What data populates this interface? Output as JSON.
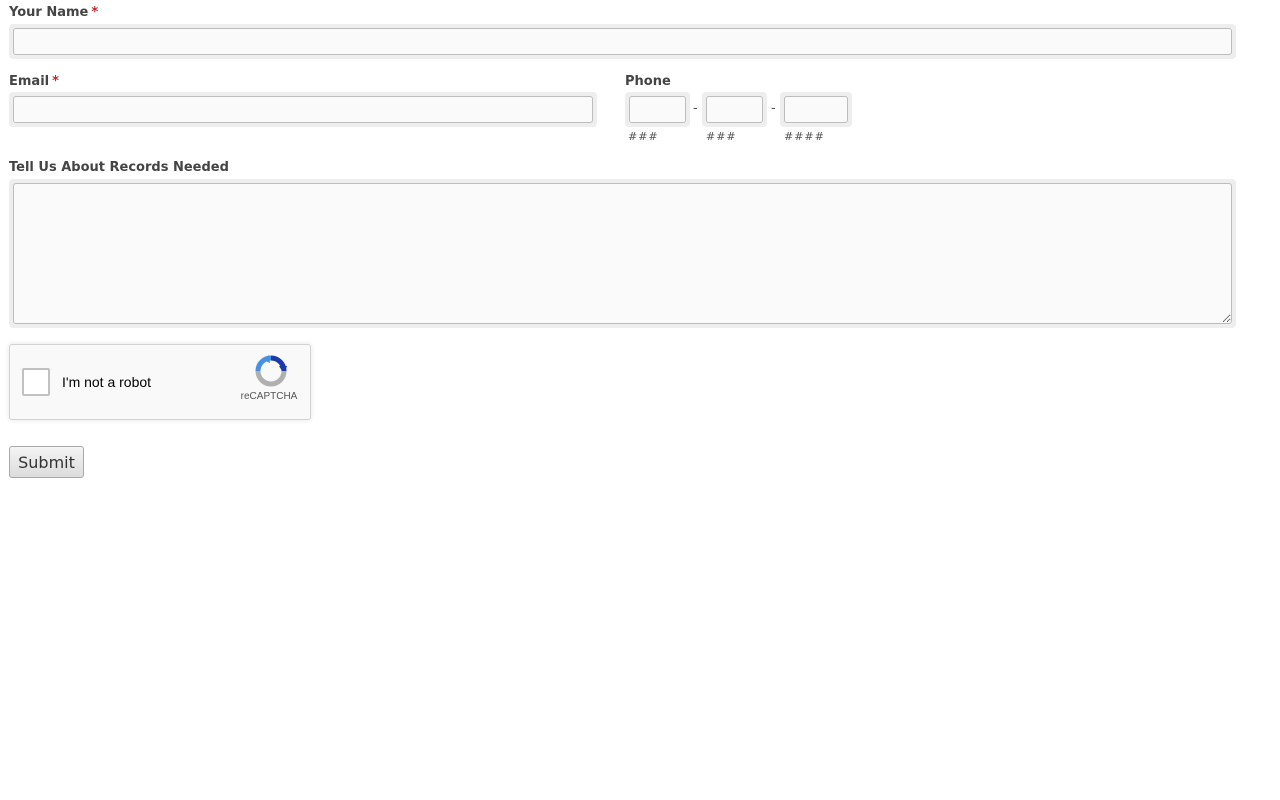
{
  "form": {
    "name": {
      "label": "Your Name",
      "required_mark": "*",
      "value": ""
    },
    "email": {
      "label": "Email",
      "required_mark": "*",
      "value": ""
    },
    "phone": {
      "label": "Phone",
      "separator": "-",
      "parts": [
        {
          "value": "",
          "hint": "###"
        },
        {
          "value": "",
          "hint": "###"
        },
        {
          "value": "",
          "hint": "####"
        }
      ]
    },
    "records": {
      "label": "Tell Us About Records Needed",
      "value": ""
    },
    "captcha": {
      "label": "I'm not a robot",
      "brand": "reCAPTCHA",
      "icon": "recaptcha-logo-icon",
      "checked": false,
      "colors": {
        "blue": "#1c3aa9",
        "light_blue": "#4a90e2",
        "gray": "#b0b0b0"
      }
    },
    "submit": {
      "label": "Submit"
    },
    "colors": {
      "required": "#c0282d",
      "label": "#444444",
      "field_frame": "#eeeeee"
    }
  }
}
